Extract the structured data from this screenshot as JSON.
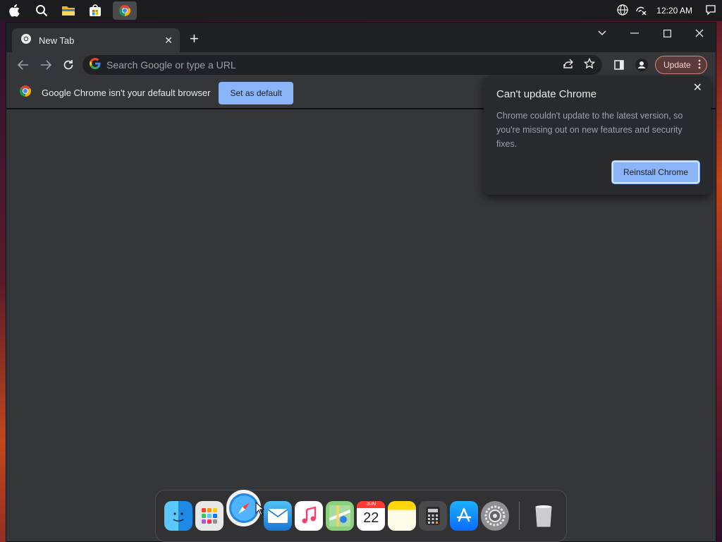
{
  "menubar": {
    "icons": [
      "apple-logo-icon",
      "search-icon",
      "file-explorer-icon",
      "store-icon",
      "chrome-icon"
    ],
    "time": "12:20 AM",
    "tray_icons": [
      "globe-icon",
      "network-icon",
      "notification-icon"
    ]
  },
  "browser": {
    "tab_title": "New Tab",
    "omnibox_placeholder": "Search Google or type a URL",
    "update_label": "Update",
    "infobar_message": "Google Chrome isn't your default browser",
    "set_default_label": "Set as default"
  },
  "bubble": {
    "title": "Can't update Chrome",
    "body": "Chrome couldn't update to the latest version, so you're missing out on new features and security fixes.",
    "button_label": "Reinstall Chrome"
  },
  "dock": {
    "apps": [
      "finder",
      "launchpad",
      "safari",
      "mail",
      "music",
      "maps",
      "calendar",
      "notes",
      "calculator",
      "app-store",
      "system-settings",
      "trash"
    ],
    "calendar_month": "JUN",
    "calendar_day": "22"
  },
  "colors": {
    "accent": "#8ab4f8",
    "update_border": "#d7857f",
    "window_bg": "#35363a",
    "titlebar_bg": "#202124"
  }
}
